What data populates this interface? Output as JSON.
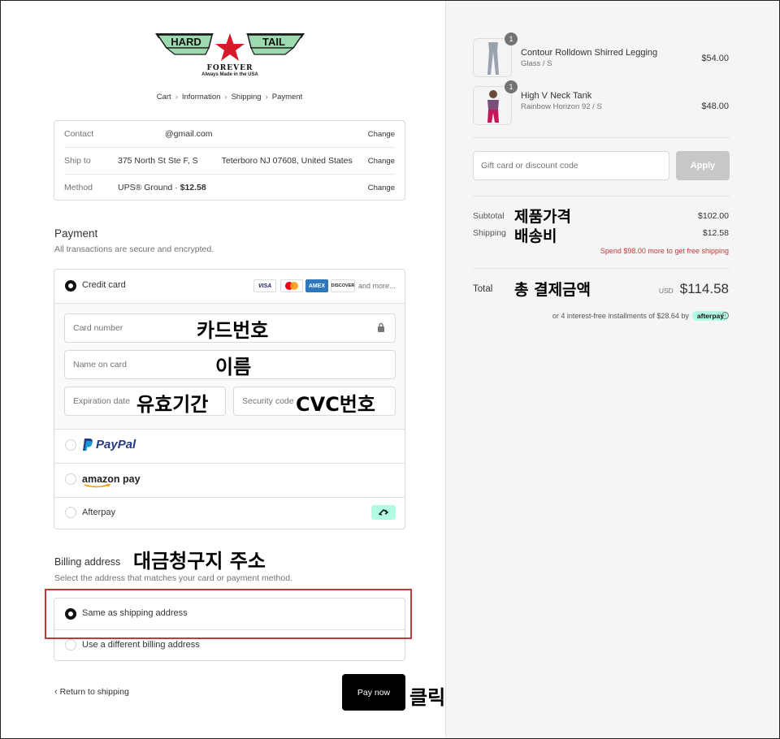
{
  "logo": {
    "left_text": "HARD",
    "right_text": "TAIL",
    "bottom_text": "FOREVER",
    "tagline": "Always Made in the USA"
  },
  "breadcrumbs": [
    "Cart",
    "Information",
    "Shipping",
    "Payment"
  ],
  "info": {
    "contact_label": "Contact",
    "contact_value": "@gmail.com",
    "ship_label": "Ship to",
    "ship_value": "375 North St Ste F, S          Teterboro NJ 07608, United States",
    "method_label": "Method",
    "method_value": "UPS® Ground · ",
    "method_price": "$12.58",
    "change": "Change"
  },
  "payment": {
    "title": "Payment",
    "subtitle": "All transactions are secure and encrypted.",
    "credit_card": "Credit card",
    "card_brands": [
      "VISA",
      "MC",
      "AMEX",
      "DISCOVER"
    ],
    "more": "and more...",
    "card_number": "Card number",
    "name_on_card": "Name on card",
    "expiration": "Expiration date",
    "security": "Security code",
    "paypal": "PayPal",
    "amazon": "amazon pay",
    "afterpay": "Afterpay"
  },
  "annotations": {
    "card_number": "카드번호",
    "name": "이름",
    "expiration": "유효기간",
    "cvc": "CVC번호",
    "billing": "대금청구지 주소",
    "click": "클릭",
    "subtotal": "제품가격",
    "shipping": "배송비",
    "total": "총 결제금액"
  },
  "billing": {
    "title": "Billing address",
    "subtitle": "Select the address that matches your card or payment method.",
    "same": "Same as shipping address",
    "different": "Use a different billing address"
  },
  "footer": {
    "return": "Return to shipping",
    "pay_now": "Pay now"
  },
  "cart": {
    "items": [
      {
        "qty": "1",
        "name": "Contour Rolldown Shirred Legging",
        "variant": "Glass / S",
        "price": "$54.00"
      },
      {
        "qty": "1",
        "name": "High V Neck Tank",
        "variant": "Rainbow Horizon 92 / S",
        "price": "$48.00"
      }
    ],
    "discount_placeholder": "Gift card or discount code",
    "apply": "Apply",
    "subtotal_label": "Subtotal",
    "subtotal": "$102.00",
    "shipping_label": "Shipping",
    "shipping": "$12.58",
    "free_ship_note": "Spend $98.00 more to get free shipping",
    "total_label": "Total",
    "currency": "USD",
    "total": "$114.58",
    "installments": "or 4 interest-free installments of $28.64 by",
    "afterpay_badge": "afterpay"
  },
  "colors": {
    "accent_red": "#c23a3a",
    "afterpay_mint": "#b2fce4",
    "paypal_blue": "#253b80",
    "paypal_light": "#179bd7"
  }
}
